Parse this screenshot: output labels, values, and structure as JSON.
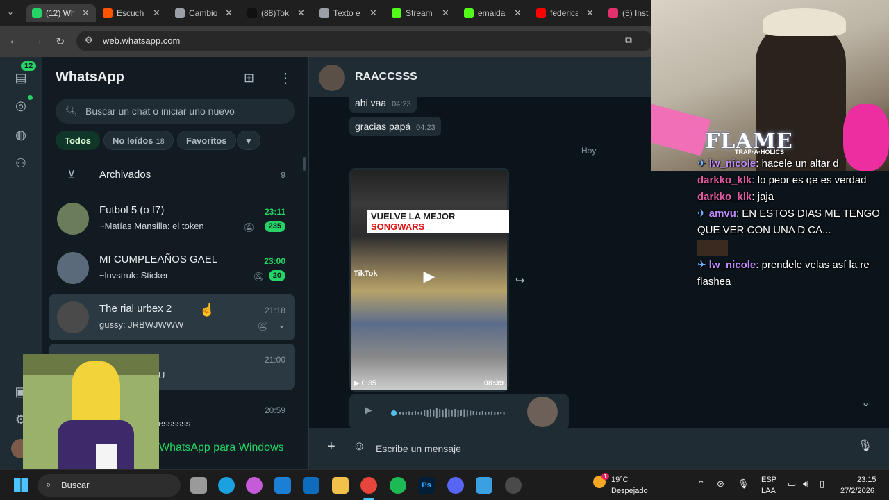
{
  "browser": {
    "tabs": [
      {
        "label": "(12) Wh",
        "color": "#25d366"
      },
      {
        "label": "Escuch",
        "color": "#ff5500"
      },
      {
        "label": "Cambio",
        "color": "#9aa0a6"
      },
      {
        "label": "(88)Tok",
        "color": "#111111"
      },
      {
        "label": "Texto e",
        "color": "#9aa0a6"
      },
      {
        "label": "Stream",
        "color": "#53fc18"
      },
      {
        "label": "emaida",
        "color": "#53fc18"
      },
      {
        "label": "federica",
        "color": "#ff0000"
      },
      {
        "label": "(5) Inst",
        "color": "#e1306c"
      }
    ],
    "url": "web.whatsapp.com"
  },
  "rail": {
    "badge": "12"
  },
  "sidebar": {
    "title": "WhatsApp",
    "search_placeholder": "Buscar un chat o iniciar uno nuevo",
    "filters": [
      {
        "label": "Todos",
        "count": ""
      },
      {
        "label": "No leídos",
        "count": "18"
      },
      {
        "label": "Favoritos",
        "count": ""
      }
    ],
    "archived": {
      "label": "Archivados",
      "count": "9"
    },
    "chats": [
      {
        "name": "Futbol 5 (o f7)",
        "preview": "~Matías Mansilla: el token",
        "time": "23:11",
        "unread": "235"
      },
      {
        "name": "MI CUMPLEAÑOS GAEL",
        "preview": "~luvstruk: Sticker",
        "time": "23:00",
        "unread": "20"
      },
      {
        "name": "The rial urbex 2",
        "preview": "gussy: JRBWJWWW",
        "time": "21:18",
        "unread": ""
      },
      {
        "name": "",
        "preview": "U",
        "time": "21:00",
        "unread": ""
      },
      {
        "name": "",
        "preview": "essssss",
        "time": "20:59",
        "unread": ""
      }
    ],
    "download_banner": "WhatsApp para Windows"
  },
  "chat": {
    "name": "RAACCSSS",
    "messages": [
      {
        "text": "ahi vaa",
        "time": "04:23"
      },
      {
        "text": "gracias papá",
        "time": "04:23"
      }
    ],
    "day_label": "Hoy",
    "video": {
      "title_a": "VUELVE LA MEJOR ",
      "title_b": "SONGWARS",
      "watermark": "TikTok",
      "duration": "0:35",
      "time": "08:39"
    },
    "composer_placeholder": "Escribe un mensaje"
  },
  "stream_chat": {
    "brand": "FLAME",
    "brand_sub": "TRAP·A·HOLICS",
    "messages": [
      {
        "user": "lw_nicole",
        "text": " hacele un altar d"
      },
      {
        "user": "darkko_klk",
        "text": " lo peor es qe es verdad"
      },
      {
        "user": "darkko_klk",
        "text": " jaja"
      },
      {
        "user": "amvu",
        "text": " EN ESTOS DIAS ME TENGO QUE VER CON UNA D CA..."
      },
      {
        "user": "lw_nicole",
        "text": " prendele velas así la re flashea"
      }
    ]
  },
  "taskbar": {
    "search_label": "Buscar",
    "weather_temp": "19°C",
    "weather_desc": "Despejado",
    "weather_badge": "1",
    "lang_a": "ESP",
    "lang_b": "LAA",
    "time": "23:15",
    "date": "27/2/2026"
  }
}
